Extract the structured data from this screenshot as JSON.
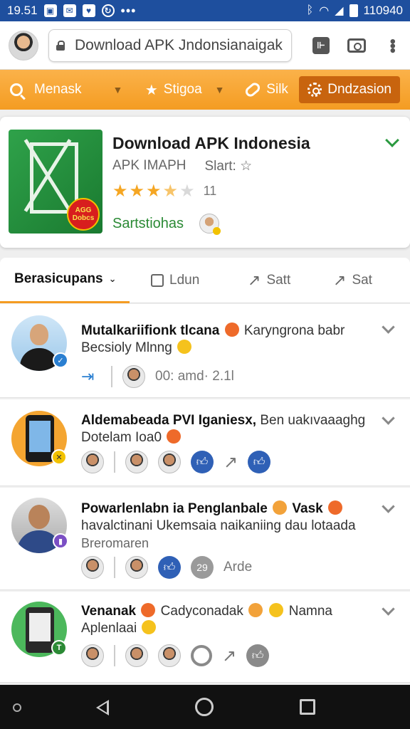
{
  "status_bar": {
    "time": "19.51",
    "right_text": "110940"
  },
  "browser": {
    "url_text": "Download APK Jndonsianaigak"
  },
  "toolbar": {
    "search_label": "Menask",
    "sort_label": "Stigoa",
    "link_label": "Silk",
    "action_label": "Dndzasion"
  },
  "app": {
    "title": "Download APK Indonesia",
    "publisher": "APK IMAPH",
    "start_label": "Slart: ☆",
    "rating": 3.5,
    "rating_count": "11",
    "status": "Sartstiohas",
    "badge_line1": "AGG",
    "badge_line2": "Dobcs"
  },
  "tabs": [
    {
      "label": "Berasicupans"
    },
    {
      "label": "Ldun"
    },
    {
      "label": "Satt"
    },
    {
      "label": "Sat"
    }
  ],
  "feed": [
    {
      "title_bold": "Mutalkariifionk tlcana",
      "title_rest": "Karyngrona babr",
      "sub": "Becsioly Mlnng",
      "meta": "00:  amd·  2.1l"
    },
    {
      "title_bold": "Aldemabeada PVI Iganiesx,",
      "title_rest": "Ben uakıvaaaghg",
      "sub": "Dotelam Ioa0"
    },
    {
      "title_bold": "Powarlenlabn ia Penglanbale",
      "title_rest": "Vask",
      "sub": "havalctinani Ukemsaia naikaniing dau lotaada",
      "sub2": "Breromaren",
      "badge": "29",
      "meta": "Arde"
    },
    {
      "title_bold": "Venanak",
      "title_rest": "Cadyconadak",
      "title_tail": "Namna",
      "sub": "Aplenlaai"
    }
  ]
}
